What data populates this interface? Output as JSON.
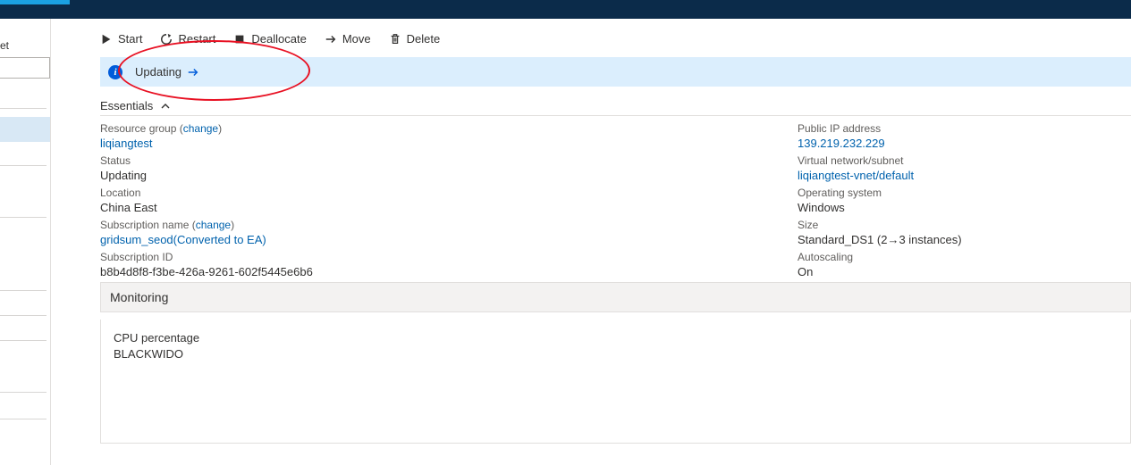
{
  "sidebar": {
    "label": "et"
  },
  "toolbar": {
    "start": "Start",
    "restart": "Restart",
    "deallocate": "Deallocate",
    "move": "Move",
    "delete": "Delete"
  },
  "banner": {
    "text": "Updating"
  },
  "essentials": {
    "title": "Essentials",
    "left": {
      "resource_group_label": "Resource group",
      "resource_group_change": "change",
      "resource_group_value": "liqiangtest",
      "status_label": "Status",
      "status_value": "Updating",
      "location_label": "Location",
      "location_value": "China East",
      "subscription_name_label": "Subscription name",
      "subscription_name_change": "change",
      "subscription_name_value": "gridsum_seod(Converted to EA)",
      "subscription_id_label": "Subscription ID",
      "subscription_id_value": "b8b4d8f8-f3be-426a-9261-602f5445e6b6"
    },
    "right": {
      "public_ip_label": "Public IP address",
      "public_ip_value": "139.219.232.229",
      "vnet_label": "Virtual network/subnet",
      "vnet_value": "liqiangtest-vnet/default",
      "os_label": "Operating system",
      "os_value": "Windows",
      "size_label": "Size",
      "size_value": "Standard_DS1 (2→3 instances)",
      "autoscaling_label": "Autoscaling",
      "autoscaling_value": "On"
    }
  },
  "monitoring": {
    "title": "Monitoring",
    "metric": "CPU percentage",
    "target": "BLACKWIDO"
  }
}
